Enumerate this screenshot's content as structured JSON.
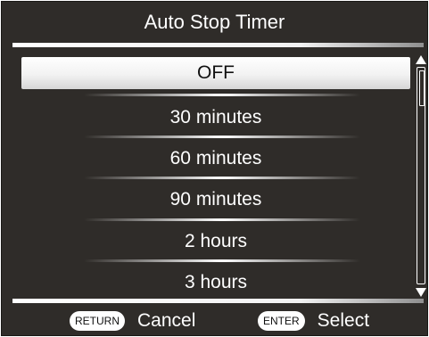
{
  "title": "Auto Stop Timer",
  "options": [
    {
      "label": "OFF",
      "selected": true
    },
    {
      "label": "30 minutes",
      "selected": false
    },
    {
      "label": "60 minutes",
      "selected": false
    },
    {
      "label": "90 minutes",
      "selected": false
    },
    {
      "label": "2 hours",
      "selected": false
    },
    {
      "label": "3 hours",
      "selected": false
    }
  ],
  "footer": {
    "return_key": "RETURN",
    "return_label": "Cancel",
    "enter_key": "ENTER",
    "enter_label": "Select"
  },
  "colors": {
    "background": "#2f2c29",
    "text": "#ffffff",
    "selected_text": "#111111"
  },
  "icons": {
    "scroll_up": "triangle-up-icon",
    "scroll_down": "triangle-down-icon"
  },
  "scroll": {
    "position_fraction": 0.0
  }
}
